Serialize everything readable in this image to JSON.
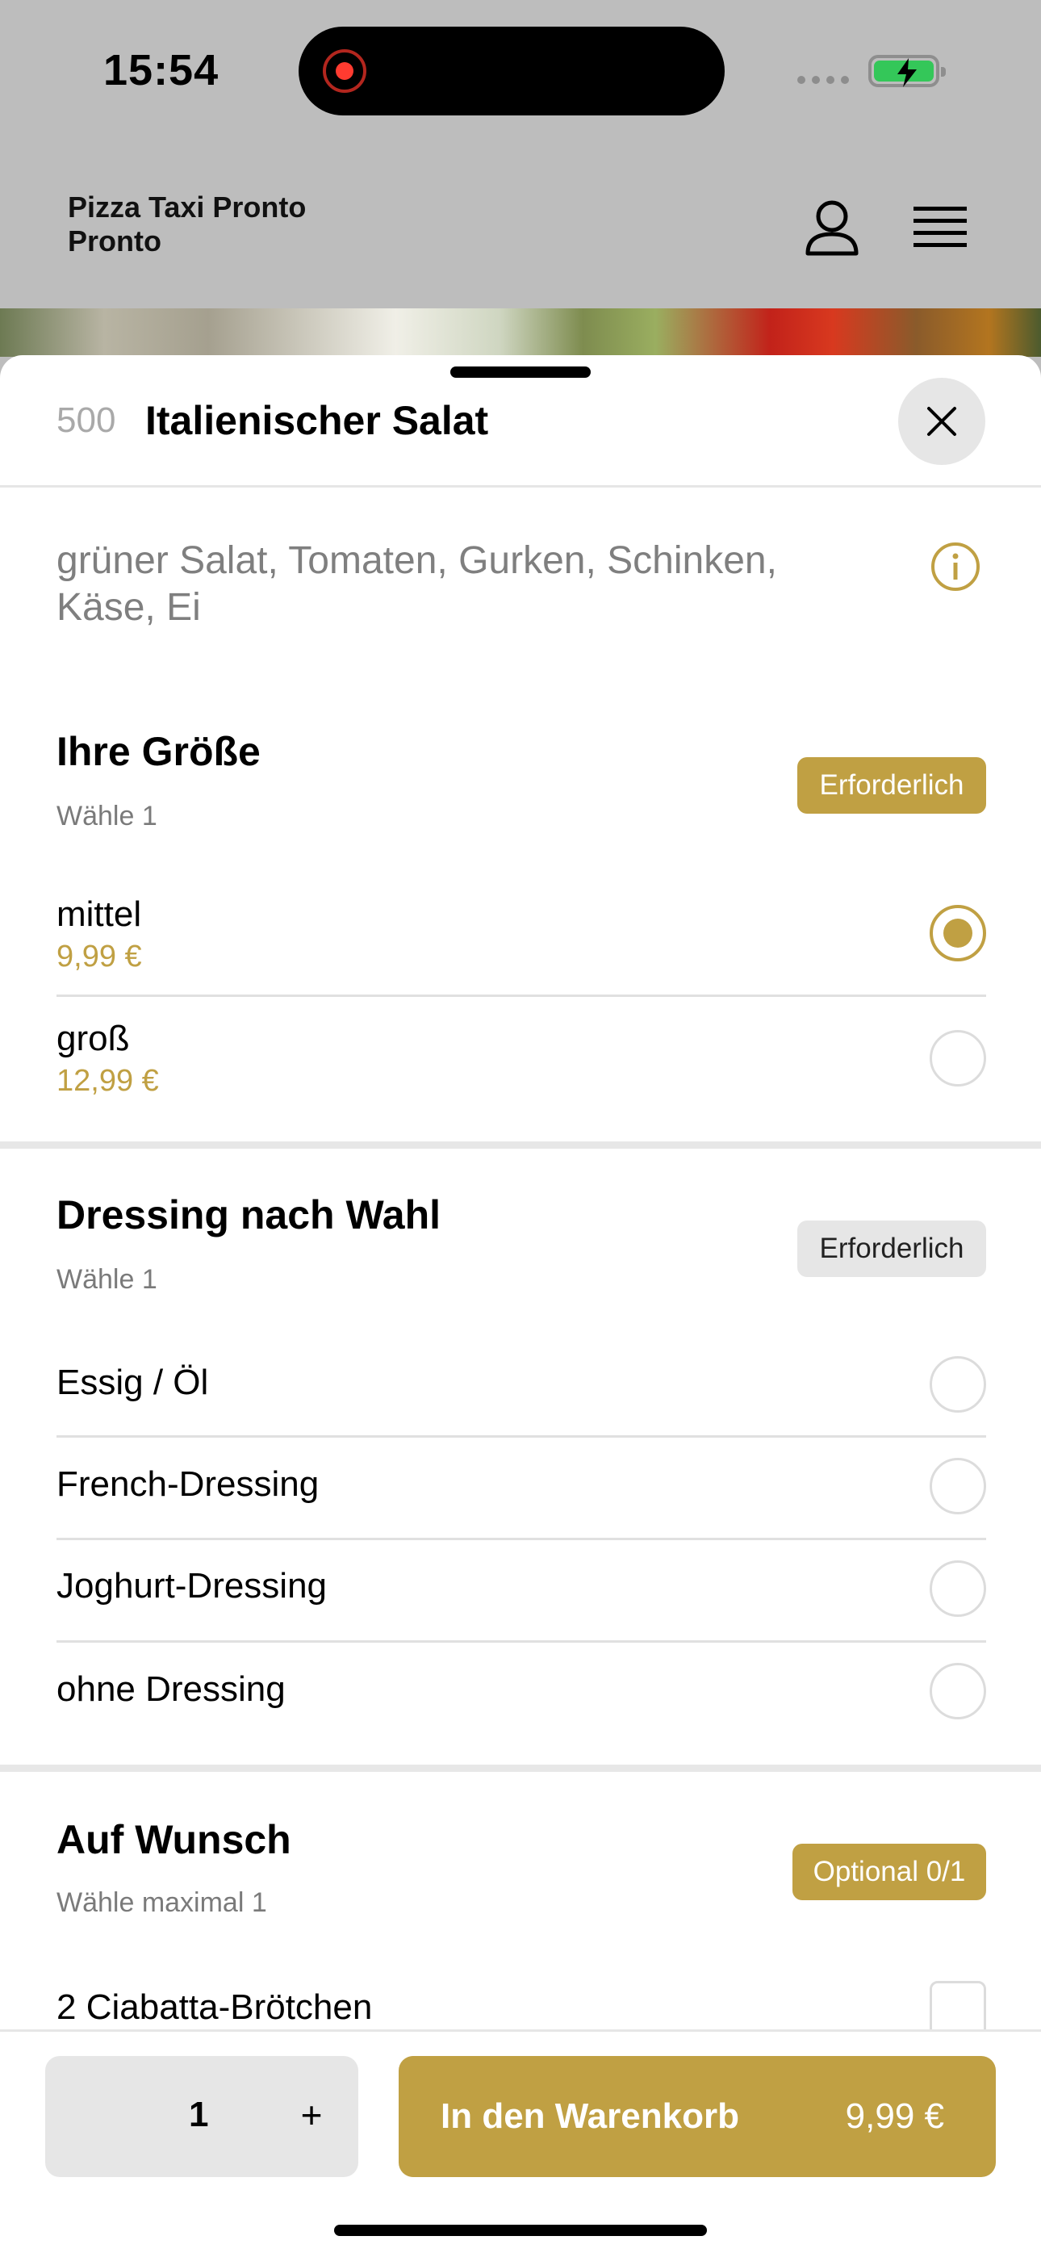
{
  "status_bar": {
    "time": "15:54"
  },
  "header": {
    "brand": "Pizza Taxi Pronto Pronto"
  },
  "item": {
    "number": "500",
    "title": "Italienischer Salat",
    "description": "grüner Salat, Tomaten, Gurken, Schinken, Käse, Ei"
  },
  "sections": [
    {
      "title": "Ihre Größe",
      "subtitle": "Wähle 1",
      "badge": "Erforderlich",
      "options": [
        {
          "name": "mittel",
          "price": "9,99 €",
          "selected": true
        },
        {
          "name": "groß",
          "price": "12,99 €",
          "selected": false
        }
      ]
    },
    {
      "title": "Dressing nach Wahl",
      "subtitle": "Wähle 1",
      "badge": "Erforderlich",
      "options": [
        {
          "name": "Essig / Öl"
        },
        {
          "name": "French-Dressing"
        },
        {
          "name": "Joghurt-Dressing"
        },
        {
          "name": "ohne Dressing"
        }
      ]
    },
    {
      "title": "Auf Wunsch",
      "subtitle": "Wähle maximal 1",
      "badge": "Optional 0/1",
      "options": [
        {
          "name": "2 Ciabatta-Brötchen"
        }
      ]
    }
  ],
  "footer": {
    "quantity": "1",
    "plus": "+",
    "cart_label": "In den Warenkorb",
    "cart_price": "9,99 €"
  },
  "colors": {
    "accent": "#c0a043",
    "badge_grey": "#e6e6e6"
  }
}
